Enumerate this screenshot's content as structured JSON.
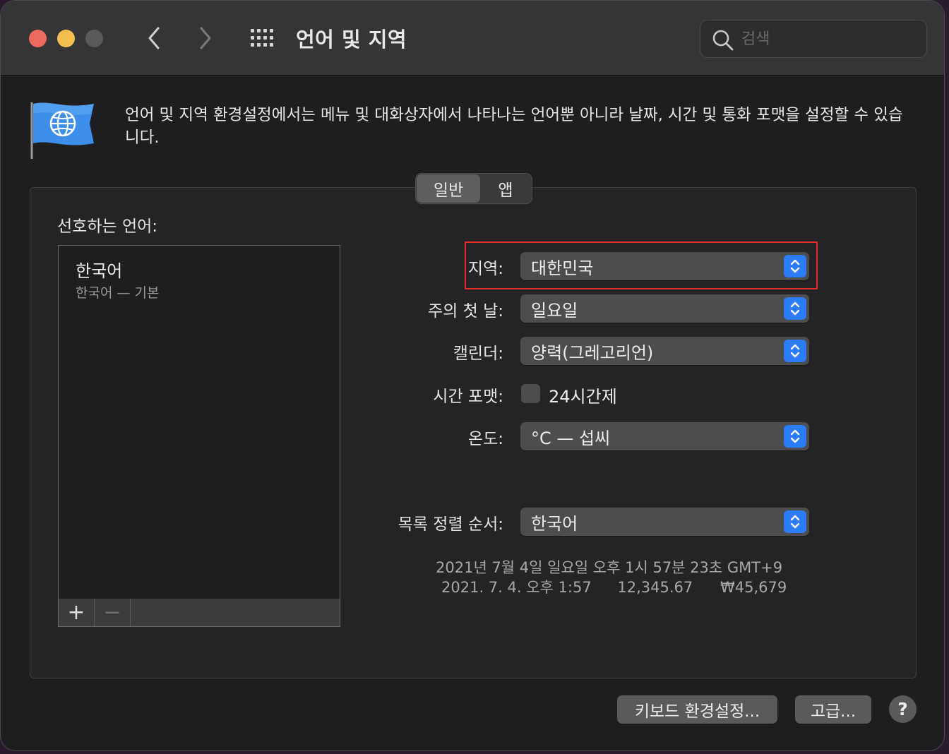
{
  "window": {
    "title": "언어 및 지역",
    "search_placeholder": "검색"
  },
  "description": "언어 및 지역 환경설정에서는 메뉴 및 대화상자에서 나타나는 언어뿐 아니라 날짜, 시간 및 통화 포맷을 설정할 수 있습니다.",
  "tabs": [
    {
      "label": "일반",
      "selected": true
    },
    {
      "label": "앱",
      "selected": false
    }
  ],
  "preferred_languages": {
    "label": "선호하는 언어:",
    "items": [
      {
        "name": "한국어",
        "subtitle": "한국어 — 기본"
      }
    ],
    "add_label": "+",
    "remove_label": "−"
  },
  "settings": {
    "region": {
      "label": "지역:",
      "value": "대한민국"
    },
    "first_day": {
      "label": "주의 첫 날:",
      "value": "일요일"
    },
    "calendar": {
      "label": "캘린더:",
      "value": "양력(그레고리언)"
    },
    "time_format": {
      "label": "시간 포맷:",
      "checkbox_label": "24시간제",
      "checked": false
    },
    "temperature": {
      "label": "온도:",
      "value": "°C — 섭씨"
    },
    "sort_order": {
      "label": "목록 정렬 순서:",
      "value": "한국어"
    }
  },
  "samples": {
    "long_date": "2021년 7월 4일 일요일 오후 1시 57분 23초 GMT+9",
    "short_date": "2021. 7. 4. 오후 1:57",
    "number": "12,345.67",
    "currency": "₩45,679"
  },
  "buttons": {
    "keyboard": "키보드 환경설정...",
    "advanced": "고급...",
    "help": "?"
  },
  "colors": {
    "accent": "#2b7cf6",
    "highlight_box": "#e02c2c"
  }
}
